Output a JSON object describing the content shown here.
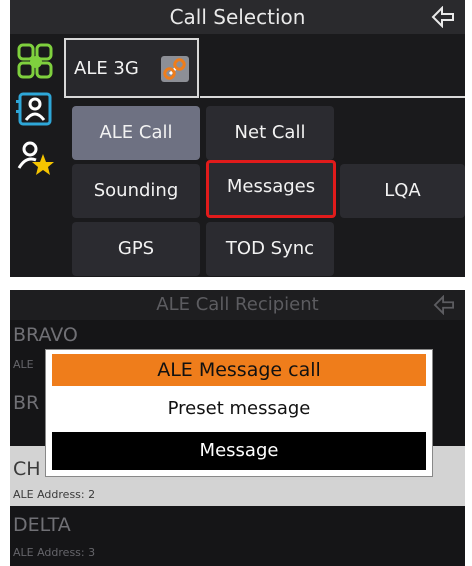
{
  "call_selection": {
    "title": "Call Selection",
    "field_value": "ALE 3G",
    "buttons": [
      {
        "label": "ALE Call"
      },
      {
        "label": "Net Call"
      },
      {
        "label": "Sounding"
      },
      {
        "label": "Messages"
      },
      {
        "label": "LQA"
      },
      {
        "label": "GPS"
      },
      {
        "label": "TOD Sync"
      }
    ]
  },
  "ale_call_recipient": {
    "title": "ALE Call Recipient",
    "rows": [
      {
        "name": "BRAVO",
        "sub": "ALE"
      },
      {
        "name": "BR",
        "sub": ""
      },
      {
        "name": "CH",
        "sub": "ALE Address: 2"
      },
      {
        "name": "DELTA",
        "sub": "ALE Address: 3"
      }
    ]
  },
  "dialog": {
    "title": "ALE Message call",
    "options": [
      "Preset message",
      "Message"
    ]
  },
  "colors": {
    "selected_border": "#e11b1b",
    "dialog_header": "#ef7d1b",
    "active_button": "#6e7182"
  }
}
